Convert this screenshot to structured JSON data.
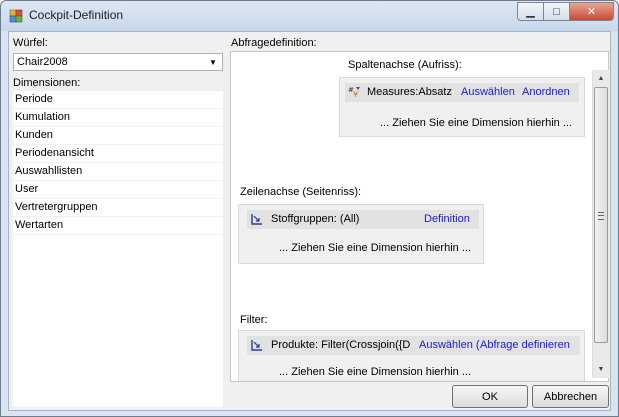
{
  "window": {
    "title": "Cockpit-Definition",
    "min_glyph": "▁",
    "max_glyph": "□",
    "close_glyph": "✕"
  },
  "left": {
    "cube_label": "Würfel:",
    "cube_value": "Chair2008",
    "dimensions_label": "Dimensionen:",
    "dimensions": [
      "Periode",
      "Kumulation",
      "Kunden",
      "Periodenansicht",
      "Auswahllisten",
      "User",
      "Vertretergruppen",
      "Wertarten"
    ]
  },
  "query": {
    "label": "Abfragedefinition:",
    "columns": {
      "label": "Spaltenachse (Aufriss):",
      "chip_text": "Measures:Absatz",
      "link1": "Auswählen",
      "link2": "Anordnen",
      "drop_hint": "... Ziehen Sie eine Dimension hierhin ..."
    },
    "rows": {
      "label": "Zeilenachse (Seitenriss):",
      "chip_text": "Stoffgruppen: (All)",
      "link1": "Definition",
      "drop_hint": "... Ziehen Sie eine Dimension hierhin ..."
    },
    "filter": {
      "label": "Filter:",
      "chip_text": "Produkte: Filter(Crossjoin({D",
      "link1": "Auswählen (",
      "link2": "Abfrage definieren",
      "drop_hint": "... Ziehen Sie eine Dimension hierhin ..."
    }
  },
  "buttons": {
    "ok": "OK",
    "cancel": "Abbrechen"
  },
  "colors": {
    "link": "#1a1ad8",
    "title_bar": "#c8d8ec"
  }
}
